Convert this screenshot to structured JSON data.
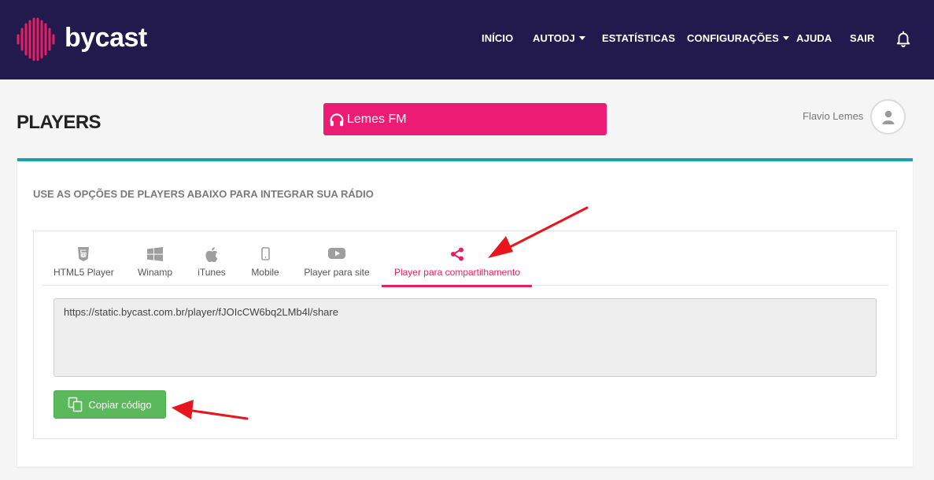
{
  "brand": {
    "name": "bycast",
    "color": "#e91e63"
  },
  "nav": {
    "items": [
      {
        "label": "INÍCIO",
        "dropdown": false
      },
      {
        "label": "AUTODJ",
        "dropdown": true
      },
      {
        "label": "ESTATÍSTICAS",
        "dropdown": false
      },
      {
        "label": "CONFIGURAÇÕES",
        "dropdown": true
      },
      {
        "label": "AJUDA",
        "dropdown": false
      },
      {
        "label": "SAIR",
        "dropdown": false
      }
    ],
    "notification_icon": "bell-icon"
  },
  "page": {
    "title": "PLAYERS",
    "radio_name": "Lemes FM",
    "user_name": "Flavio Lemes"
  },
  "panel": {
    "heading": "USE AS OPÇÕES DE PLAYERS ABAIXO PARA INTEGRAR SUA RÁDIO",
    "tabs": [
      {
        "label": "HTML5 Player",
        "icon": "html5-icon"
      },
      {
        "label": "Winamp",
        "icon": "windows-icon"
      },
      {
        "label": "iTunes",
        "icon": "apple-icon"
      },
      {
        "label": "Mobile",
        "icon": "mobile-icon"
      },
      {
        "label": "Player para site",
        "icon": "youtube-icon"
      },
      {
        "label": "Player para compartilhamento",
        "icon": "share-icon",
        "active": true
      }
    ],
    "code_value": "https://static.bycast.com.br/player/fJOIcCW6bq2LMb4l/share",
    "copy_button_label": "Copiar código"
  },
  "colors": {
    "navbar": "#221a4c",
    "accent": "#e91e63",
    "panel_border": "#17a2b0",
    "button": "#5cb85c",
    "annotation_arrow": "#e8161c"
  }
}
